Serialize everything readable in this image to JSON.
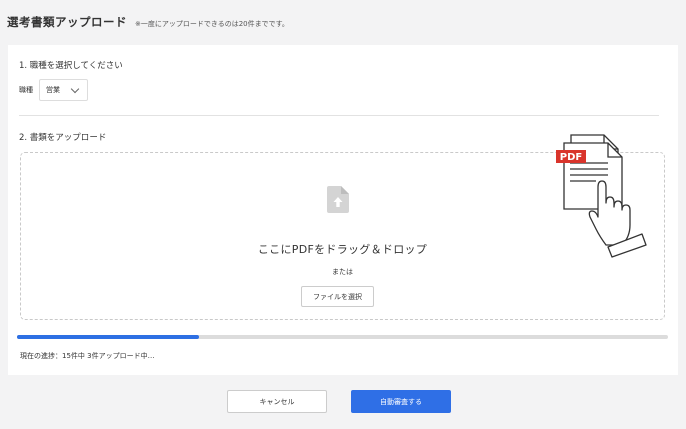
{
  "header": {
    "title": "選考書類アップロード",
    "note": "※一度にアップロードできるのは20件までです。"
  },
  "step1": {
    "title": "1. 職種を選択してください",
    "job_label": "職種",
    "job_value": "営業"
  },
  "step2": {
    "title": "2. 書類をアップロード",
    "drop_text": "ここにPDFをドラッグ＆ドロップ",
    "or_text": "または",
    "select_file_label": "ファイルを選択",
    "pdf_badge": "PDF"
  },
  "progress": {
    "completed": 3,
    "total": 15,
    "fraction": 0.28,
    "text": "現在の進捗：15件中 3件アップロード中…"
  },
  "footer": {
    "cancel_label": "キャンセル",
    "submit_label": "自動審査する"
  },
  "colors": {
    "accent": "#2f6fe6",
    "pdf_badge": "#d9342b"
  }
}
